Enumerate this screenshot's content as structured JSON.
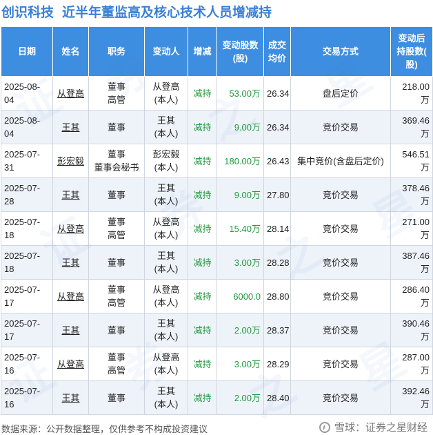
{
  "header": {
    "stock_name": "创识科技",
    "title": "近半年董监高及核心技术人员增减持"
  },
  "table": {
    "columns": [
      [
        "日期"
      ],
      [
        "姓名"
      ],
      [
        "职务"
      ],
      [
        "变动人"
      ],
      [
        "增减"
      ],
      [
        "变动股数",
        "(股)"
      ],
      [
        "成交",
        "均价"
      ],
      [
        "交易方式"
      ],
      [
        "变动后",
        "持股数(",
        "股)"
      ]
    ],
    "rows": [
      {
        "date": "2025-08-04",
        "name": "从登高",
        "role": [
          "董事",
          "高管"
        ],
        "changer": [
          "从登高",
          "(本人)"
        ],
        "dir": "减持",
        "shares": "53.00万",
        "price": "26.34",
        "method": "盘后定价",
        "after": "218.00万"
      },
      {
        "date": "2025-08-04",
        "name": "王其",
        "role": [
          "董事"
        ],
        "changer": [
          "王其",
          "(本人)"
        ],
        "dir": "减持",
        "shares": "9.00万",
        "price": "26.34",
        "method": "竞价交易",
        "after": "369.46万"
      },
      {
        "date": "2025-07-31",
        "name": "彭宏毅",
        "role": [
          "董事",
          "董事会秘书"
        ],
        "changer": [
          "彭宏毅",
          "(本人)"
        ],
        "dir": "减持",
        "shares": "180.00万",
        "price": "26.43",
        "method": "集中竞价(含盘后定价)",
        "after": "546.51万"
      },
      {
        "date": "2025-07-28",
        "name": "王其",
        "role": [
          "董事"
        ],
        "changer": [
          "王其",
          "(本人)"
        ],
        "dir": "减持",
        "shares": "9.00万",
        "price": "27.80",
        "method": "竞价交易",
        "after": "378.46万"
      },
      {
        "date": "2025-07-18",
        "name": "从登高",
        "role": [
          "董事",
          "高管"
        ],
        "changer": [
          "从登高",
          "(本人)"
        ],
        "dir": "减持",
        "shares": "15.40万",
        "price": "28.14",
        "method": "竞价交易",
        "after": "271.00万"
      },
      {
        "date": "2025-07-18",
        "name": "王其",
        "role": [
          "董事"
        ],
        "changer": [
          "王其",
          "(本人)"
        ],
        "dir": "减持",
        "shares": "3.00万",
        "price": "28.28",
        "method": "竞价交易",
        "after": "387.46万"
      },
      {
        "date": "2025-07-17",
        "name": "从登高",
        "role": [
          "董事",
          "高管"
        ],
        "changer": [
          "从登高",
          "(本人)"
        ],
        "dir": "减持",
        "shares": "6000.0",
        "price": "28.80",
        "method": "竞价交易",
        "after": "286.40万"
      },
      {
        "date": "2025-07-17",
        "name": "王其",
        "role": [
          "董事"
        ],
        "changer": [
          "王其",
          "(本人)"
        ],
        "dir": "减持",
        "shares": "2.00万",
        "price": "28.37",
        "method": "竞价交易",
        "after": "390.46万"
      },
      {
        "date": "2025-07-16",
        "name": "从登高",
        "role": [
          "董事",
          "高管"
        ],
        "changer": [
          "从登高",
          "(本人)"
        ],
        "dir": "减持",
        "shares": "3.00万",
        "price": "28.29",
        "method": "竞价交易",
        "after": "287.00万"
      },
      {
        "date": "2025-07-16",
        "name": "王其",
        "role": [
          "董事"
        ],
        "changer": [
          "王其",
          "(本人)"
        ],
        "dir": "减持",
        "shares": "2.00万",
        "price": "28.40",
        "method": "竞价交易",
        "after": "392.46万"
      }
    ]
  },
  "footer": {
    "source": "数据来源：公开数据整理，仅供参考不构成投资建议",
    "brand": "雪球：证券之星财经"
  },
  "colors": {
    "header_bg": "#3D8EE0",
    "title": "#3A7FD5",
    "decrease": "#1F9A3A",
    "stripe": "#EEF3FA"
  },
  "watermark": [
    "证",
    "券",
    "之",
    "星"
  ]
}
